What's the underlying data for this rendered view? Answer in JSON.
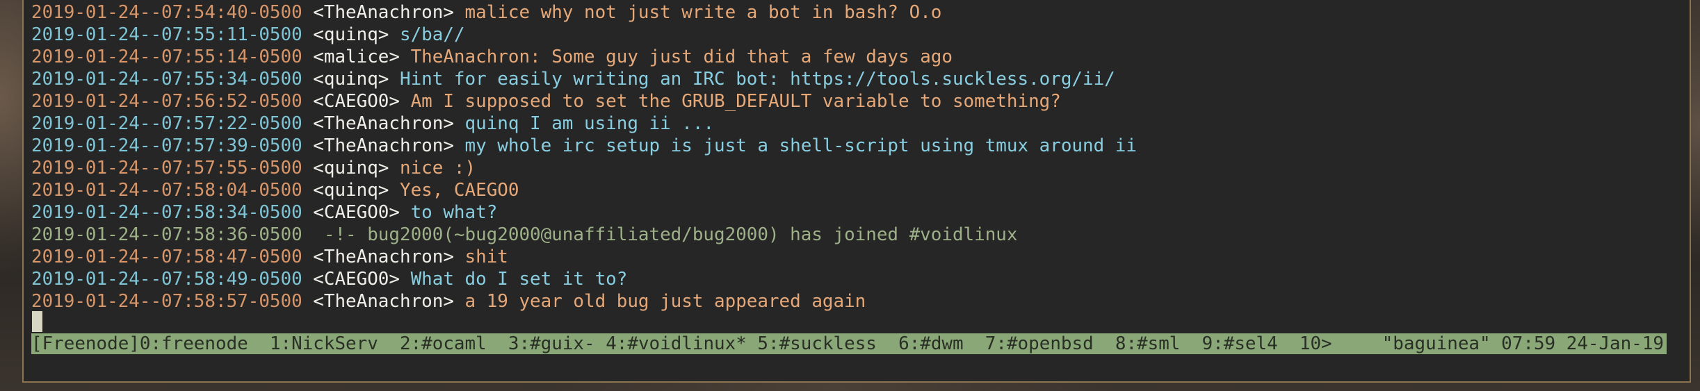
{
  "terminal": {
    "lines": [
      {
        "ts": "2019-01-24--07:54:40-0500",
        "nick": "<TheAnachron>",
        "msg": "malice why not just write a bot in bash? O.o"
      },
      {
        "ts": "2019-01-24--07:55:11-0500",
        "nick": "<quinq>",
        "msg": "s/ba//"
      },
      {
        "ts": "2019-01-24--07:55:14-0500",
        "nick": "<malice>",
        "msg": "TheAnachron: Some guy just did that a few days ago"
      },
      {
        "ts": "2019-01-24--07:55:34-0500",
        "nick": "<quinq>",
        "msg": "Hint for easily writing an IRC bot: https://tools.suckless.org/ii/"
      },
      {
        "ts": "2019-01-24--07:56:52-0500",
        "nick": "<CAEGO0>",
        "msg": "Am I supposed to set the GRUB_DEFAULT variable to something?"
      },
      {
        "ts": "2019-01-24--07:57:22-0500",
        "nick": "<TheAnachron>",
        "msg": "quinq I am using ii ..."
      },
      {
        "ts": "2019-01-24--07:57:39-0500",
        "nick": "<TheAnachron>",
        "msg": "my whole irc setup is just a shell-script using tmux around ii"
      },
      {
        "ts": "2019-01-24--07:57:55-0500",
        "nick": "<quinq>",
        "msg": "nice :)"
      },
      {
        "ts": "2019-01-24--07:58:04-0500",
        "nick": "<quinq>",
        "msg": "Yes, CAEGO0"
      },
      {
        "ts": "2019-01-24--07:58:34-0500",
        "nick": "<CAEGO0>",
        "msg": "to what?"
      },
      {
        "ts": "2019-01-24--07:58:36-0500",
        "nick": "",
        "msg": " -!- bug2000(~bug2000@unaffiliated/bug2000) has joined #voidlinux"
      },
      {
        "ts": "2019-01-24--07:58:47-0500",
        "nick": "<TheAnachron>",
        "msg": "shit"
      },
      {
        "ts": "2019-01-24--07:58:49-0500",
        "nick": "<CAEGO0>",
        "msg": "What do I set it to?"
      },
      {
        "ts": "2019-01-24--07:58:57-0500",
        "nick": "<TheAnachron>",
        "msg": "a 19 year old bug just appeared again"
      }
    ]
  },
  "statusbar": {
    "session": "[Freenode]",
    "windows": [
      "0:freenode ",
      "1:NickServ ",
      "2:#ocaml ",
      "3:#guix- ",
      "4:#voidlinux* ",
      "5:#suckless ",
      "6:#dwm ",
      "7:#openbsd ",
      "8:#sml ",
      "9:#sel4 ",
      "10>"
    ],
    "right": "\"baguinea\" 07:59 24-Jan-19"
  },
  "colors": {
    "timestamp_odd": "#d7956a",
    "timestamp_even": "#7fc4d4",
    "statusbar_bg": "#8aa877",
    "terminal_border": "#8a7452"
  }
}
